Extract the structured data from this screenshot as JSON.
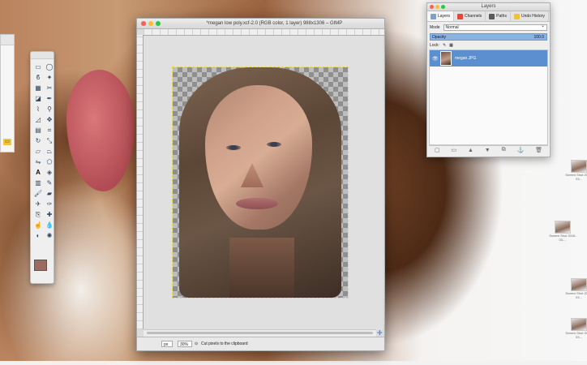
{
  "gimp_window": {
    "title": "*megan low poly.xcf-2.0 (RGB color, 1 layer) 988x1306 – GIMP",
    "status": {
      "units": "px",
      "zoom": "30%",
      "message": "Cut pixels to the clipboard"
    }
  },
  "layers_dock": {
    "title": "Layers",
    "tabs": [
      "Layers",
      "Channels",
      "Paths",
      "Undo History"
    ],
    "mode_label": "Mode",
    "mode_value": "Normal",
    "opacity_label": "Opacity",
    "opacity_value": "100.0",
    "lock_label": "Lock:",
    "layer_name": "megan.JPG"
  },
  "toolbox": {
    "fg_color": "#9b6b60",
    "bg_color": "#ffffff"
  },
  "desktop_icons": [
    {
      "label": "Screen Shot 2016-03...",
      "icon": "screenshot-thumbnail"
    },
    {
      "label": "Screen Shot 2016-03-...",
      "icon": "screenshot-thumbnail"
    },
    {
      "label": "Screen Shot 2016-03...",
      "icon": "screenshot-thumbnail"
    },
    {
      "label": "Screen Shot 2016-03...",
      "icon": "screenshot-thumbnail"
    }
  ]
}
